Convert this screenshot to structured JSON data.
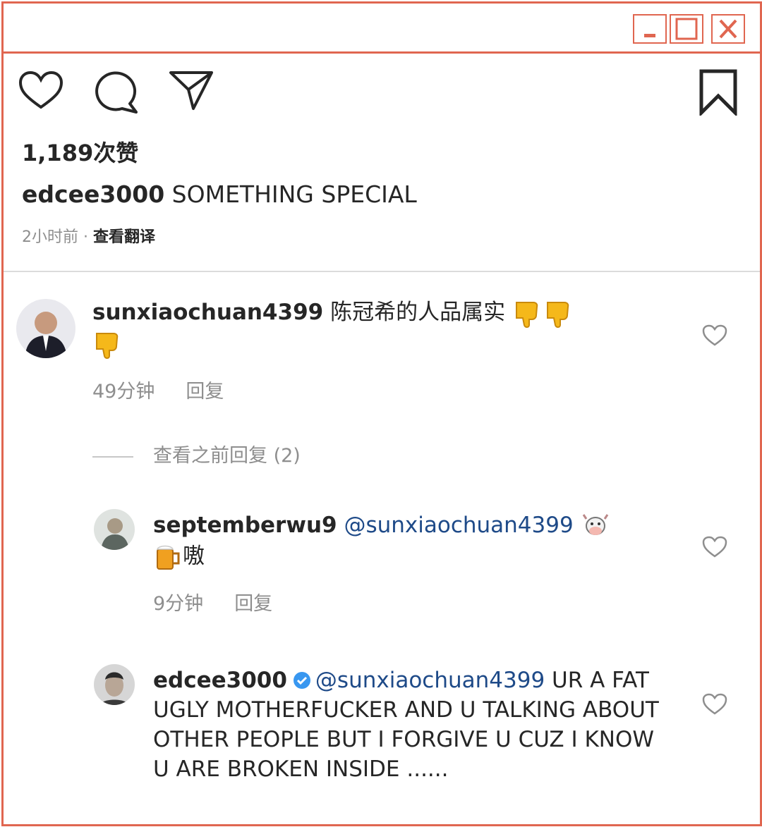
{
  "window": {
    "controls": [
      "minimize",
      "maximize",
      "close"
    ]
  },
  "post": {
    "likes": "1,189次赞",
    "caption_user": "edcee3000",
    "caption_text": " SOMETHING SPECIAL",
    "time": "2小时前",
    "separator": " · ",
    "translate": "查看翻译"
  },
  "comments": [
    {
      "user": "sunxiaochuan4399",
      "text": " 陈冠希的人品属实",
      "time": "49分钟",
      "reply": "回复"
    }
  ],
  "view_previous": "查看之前回复 (2)",
  "replies": [
    {
      "user": "septemberwu9",
      "mention": " @sunxiaochuan4399",
      "text": "嗷",
      "time": "9分钟",
      "reply": "回复"
    },
    {
      "user": "edcee3000",
      "mention": "@sunxiaochuan4399",
      "text": " UR A FAT UGLY MOTHERFUCKER AND U TALKING ABOUT OTHER PEOPLE BUT I FORGIVE U CUZ I KNOW U ARE BROKEN INSIDE ......"
    }
  ],
  "colors": {
    "frame": "#e06650",
    "mention": "#1e4a88",
    "muted": "#8e8e8e",
    "text": "#262626"
  }
}
